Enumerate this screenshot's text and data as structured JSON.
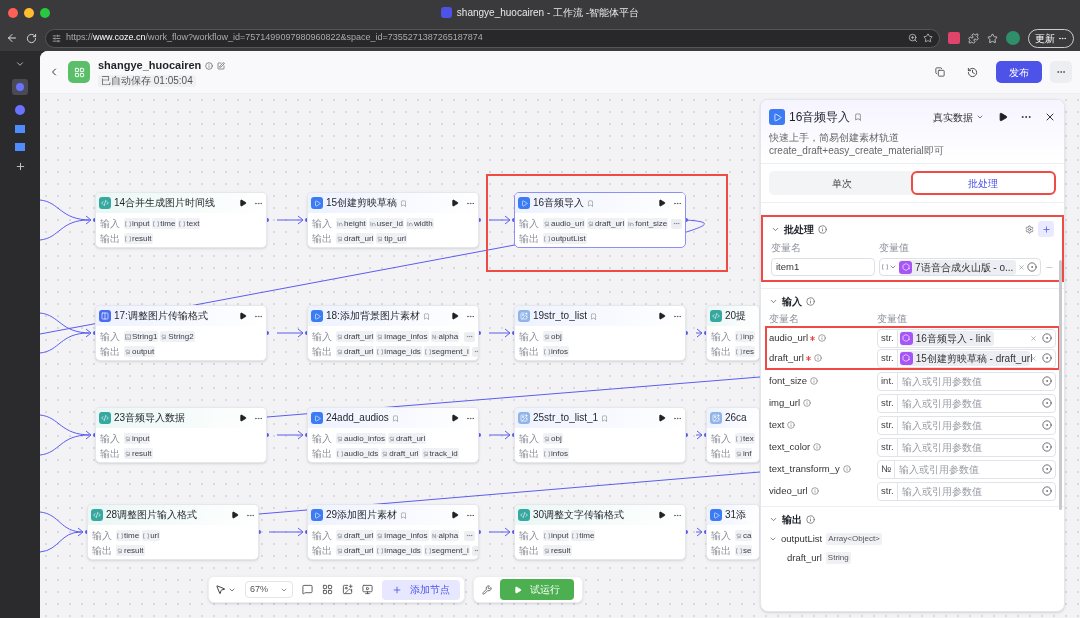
{
  "browser": {
    "title": "shangye_huocairen - 工作流 -智能体平台",
    "url_prefix": "https://",
    "url_host": "www.coze.cn",
    "url_rest": "/work_flow?workflow_id=7571499097980960822&space_id=7355271387265187874",
    "update_button": "更新"
  },
  "header": {
    "name": "shangye_huocairen",
    "autosave": "已自动保存 01:05:04",
    "publish": "发布"
  },
  "canvas": {
    "rows": [
      [
        {
          "title": "14合并生成图片时间线",
          "kind": "code",
          "badge": false,
          "selected": false,
          "highlighted": false,
          "in_label": "输入",
          "out_label": "输出",
          "inputs": [
            {
              "kind": "array",
              "name": "input"
            },
            {
              "kind": "array",
              "name": "time"
            },
            {
              "kind": "array",
              "name": "text"
            }
          ],
          "inputs_more": false,
          "outputs": [
            {
              "kind": "array",
              "name": "result"
            }
          ],
          "outputs_more": false
        },
        {
          "title": "15创建剪映草稿",
          "kind": "plugin",
          "badge": true,
          "selected": false,
          "highlighted": false,
          "in_label": "输入",
          "out_label": "输出",
          "inputs": [
            {
              "kind": "int",
              "name": "height"
            },
            {
              "kind": "int",
              "name": "user_id"
            },
            {
              "kind": "int",
              "name": "width"
            }
          ],
          "inputs_more": false,
          "outputs": [
            {
              "kind": "str",
              "name": "draft_url"
            },
            {
              "kind": "str",
              "name": "tip_url"
            }
          ],
          "outputs_more": false
        },
        {
          "title": "16音频导入",
          "kind": "plugin",
          "badge": true,
          "selected": true,
          "highlighted": true,
          "in_label": "输入",
          "out_label": "输出",
          "inputs": [
            {
              "kind": "str",
              "name": "audio_url"
            },
            {
              "kind": "str",
              "name": "draft_url"
            },
            {
              "kind": "int",
              "name": "font_size"
            }
          ],
          "inputs_more": true,
          "outputs": [
            {
              "kind": "array",
              "name": "outputList"
            }
          ],
          "outputs_more": false
        }
      ],
      [
        {
          "title": "17:调整图片传输格式",
          "kind": "workflow",
          "badge": false,
          "selected": false,
          "highlighted": false,
          "in_label": "输入",
          "out_label": "输出",
          "inputs": [
            {
              "kind": "image",
              "name": "String1"
            },
            {
              "kind": "str",
              "name": "String2"
            }
          ],
          "inputs_more": false,
          "outputs": [
            {
              "kind": "str",
              "name": "output"
            }
          ],
          "outputs_more": false
        },
        {
          "title": "18:添加背景图片素材",
          "kind": "plugin",
          "badge": true,
          "selected": false,
          "highlighted": false,
          "in_label": "输入",
          "out_label": "输出",
          "inputs": [
            {
              "kind": "str",
              "name": "draft_url"
            },
            {
              "kind": "str",
              "name": "image_infos"
            },
            {
              "kind": "num",
              "name": "alpha"
            }
          ],
          "inputs_more": true,
          "outputs": [
            {
              "kind": "str",
              "name": "draft_url"
            },
            {
              "kind": "array",
              "name": "image_ids"
            },
            {
              "kind": "array",
              "name": "segment_i"
            }
          ],
          "outputs_more": true
        },
        {
          "title": "19str_to_list",
          "kind": "image",
          "badge": true,
          "selected": false,
          "highlighted": false,
          "in_label": "输入",
          "out_label": "输出",
          "inputs": [
            {
              "kind": "str",
              "name": "obj"
            }
          ],
          "inputs_more": false,
          "outputs": [
            {
              "kind": "array",
              "name": "infos"
            }
          ],
          "outputs_more": false
        },
        {
          "title": "20提",
          "kind": "code",
          "selected": false,
          "highlighted": false,
          "in_label": "输入",
          "out_label": "输出",
          "inputs": [
            {
              "kind": "array",
              "name": "inp"
            }
          ],
          "inputs_more": false,
          "outputs": [
            {
              "kind": "array",
              "name": "res"
            }
          ],
          "outputs_more": false
        }
      ],
      [
        {
          "title": "23音频导入数据",
          "kind": "code",
          "badge": false,
          "selected": false,
          "highlighted": false,
          "in_label": "输入",
          "out_label": "输出",
          "inputs": [
            {
              "kind": "str",
              "name": "input"
            }
          ],
          "inputs_more": false,
          "outputs": [
            {
              "kind": "str",
              "name": "result"
            }
          ],
          "outputs_more": false
        },
        {
          "title": "24add_audios",
          "kind": "plugin",
          "badge": true,
          "selected": false,
          "highlighted": false,
          "in_label": "输入",
          "out_label": "输出",
          "inputs": [
            {
              "kind": "str",
              "name": "audio_infos"
            },
            {
              "kind": "str",
              "name": "draft_url"
            }
          ],
          "inputs_more": false,
          "outputs": [
            {
              "kind": "array",
              "name": "audio_ids"
            },
            {
              "kind": "str",
              "name": "draft_url"
            },
            {
              "kind": "str",
              "name": "track_id"
            }
          ],
          "outputs_more": false
        },
        {
          "title": "25str_to_list_1",
          "kind": "image",
          "badge": true,
          "selected": false,
          "highlighted": false,
          "in_label": "输入",
          "out_label": "输出",
          "inputs": [
            {
              "kind": "str",
              "name": "obj"
            }
          ],
          "inputs_more": false,
          "outputs": [
            {
              "kind": "array",
              "name": "infos"
            }
          ],
          "outputs_more": false
        },
        {
          "title": "26ca",
          "kind": "image",
          "selected": false,
          "highlighted": false,
          "in_label": "输入",
          "out_label": "输出",
          "inputs": [
            {
              "kind": "array",
              "name": "tex"
            }
          ],
          "inputs_more": false,
          "outputs": [
            {
              "kind": "str",
              "name": "inf"
            }
          ],
          "outputs_more": false
        }
      ],
      [
        {
          "title": "28调整图片输入格式",
          "kind": "code",
          "badge": false,
          "selected": false,
          "highlighted": false,
          "in_label": "输入",
          "out_label": "输出",
          "inputs": [
            {
              "kind": "array",
              "name": "time"
            },
            {
              "kind": "array",
              "name": "url"
            }
          ],
          "inputs_more": false,
          "outputs": [
            {
              "kind": "str",
              "name": "result"
            }
          ],
          "outputs_more": false
        },
        {
          "title": "29添加图片素材",
          "kind": "plugin",
          "badge": true,
          "selected": false,
          "highlighted": false,
          "in_label": "输入",
          "out_label": "输出",
          "inputs": [
            {
              "kind": "str",
              "name": "draft_url"
            },
            {
              "kind": "str",
              "name": "image_infos"
            },
            {
              "kind": "num",
              "name": "alpha"
            }
          ],
          "inputs_more": true,
          "outputs": [
            {
              "kind": "str",
              "name": "draft_url"
            },
            {
              "kind": "array",
              "name": "image_ids"
            },
            {
              "kind": "array",
              "name": "segment_i"
            }
          ],
          "outputs_more": true
        },
        {
          "title": "30调整文字传输格式",
          "kind": "code",
          "badge": false,
          "selected": false,
          "highlighted": false,
          "in_label": "输入",
          "out_label": "输出",
          "inputs": [
            {
              "kind": "array",
              "name": "input"
            },
            {
              "kind": "array",
              "name": "time"
            }
          ],
          "inputs_more": false,
          "outputs": [
            {
              "kind": "str",
              "name": "result"
            }
          ],
          "outputs_more": false
        },
        {
          "title": "31添",
          "kind": "plugin",
          "selected": false,
          "highlighted": false,
          "in_label": "输入",
          "out_label": "输出",
          "inputs": [
            {
              "kind": "str",
              "name": "ca"
            }
          ],
          "inputs_more": false,
          "outputs": [
            {
              "kind": "array",
              "name": "se"
            }
          ],
          "outputs_more": false
        }
      ]
    ]
  },
  "toolbar": {
    "zoom": "67%",
    "add_node": "添加节点",
    "test_run": "试运行"
  },
  "panel": {
    "title": "16音频导入",
    "mode": "真实数据",
    "description": [
      "快速上手，简易创建素材轨道",
      "create_draft+easy_create_material即可"
    ],
    "tabs": [
      {
        "label": "单次",
        "selected": false,
        "highlighted": false
      },
      {
        "label": "批处理",
        "selected": true,
        "highlighted": true
      }
    ],
    "batch": {
      "title": "批处理",
      "highlighted": true,
      "col_name": "变量名",
      "col_value": "变量值",
      "items": [
        {
          "name": "item1",
          "ref": "7语音合成火山版 - o..."
        }
      ]
    },
    "inputs": {
      "title": "输入",
      "col_name": "变量名",
      "col_value": "变量值",
      "params": [
        {
          "name": "audio_url",
          "required": true,
          "type": "str.",
          "ref": "16音频导入 - link",
          "highlighted": true
        },
        {
          "name": "draft_url",
          "required": true,
          "type": "str.",
          "ref": "15创建剪映草稿 - draft_url",
          "highlighted": true
        },
        {
          "name": "font_size",
          "required": false,
          "type": "int.",
          "placeholder": "输入或引用参数值",
          "highlighted": false
        },
        {
          "name": "img_url",
          "required": false,
          "type": "str.",
          "placeholder": "输入或引用参数值",
          "highlighted": false
        },
        {
          "name": "text",
          "required": false,
          "type": "str.",
          "placeholder": "输入或引用参数值",
          "highlighted": false
        },
        {
          "name": "text_color",
          "required": false,
          "type": "str.",
          "placeholder": "输入或引用参数值",
          "highlighted": false
        },
        {
          "name": "text_transform_y",
          "required": false,
          "type": "№",
          "placeholder": "输入或引用参数值",
          "highlighted": false
        },
        {
          "name": "video_url",
          "required": false,
          "type": "str.",
          "placeholder": "输入或引用参数值",
          "highlighted": false
        }
      ]
    },
    "outputs": {
      "title": "输出",
      "items": [
        {
          "name": "outputList",
          "type": "Array<Object>",
          "expanded": true,
          "children": [
            {
              "name": "draft_url",
              "type": "String"
            }
          ]
        }
      ]
    }
  }
}
